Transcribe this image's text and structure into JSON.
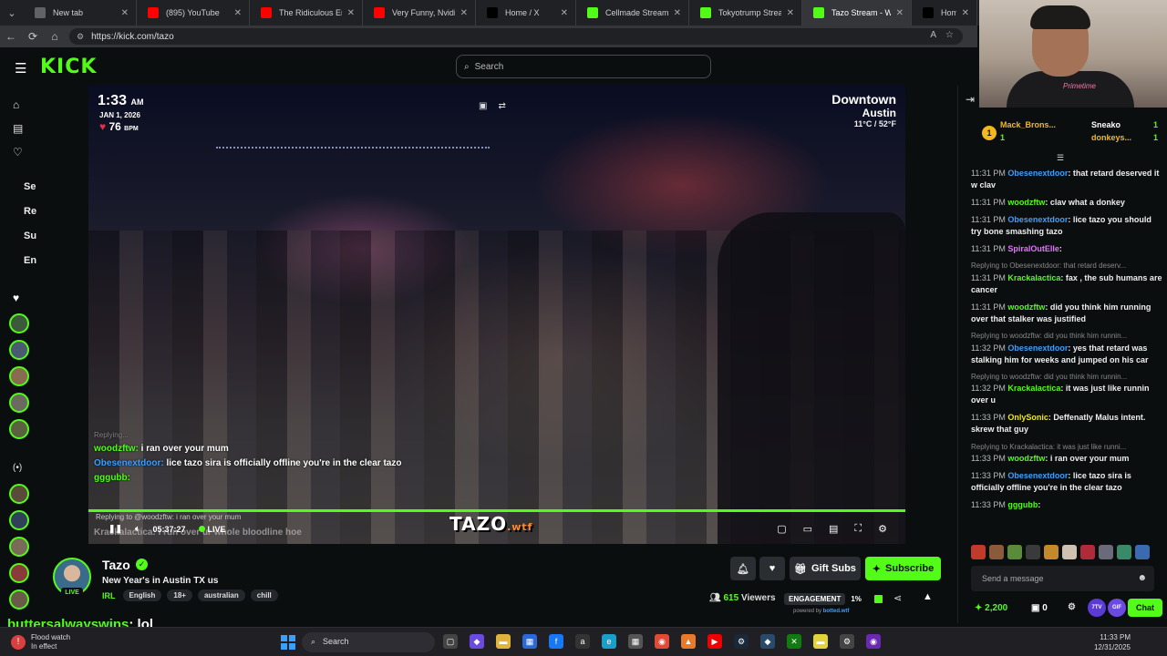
{
  "browser": {
    "tabs": [
      {
        "title": "New tab",
        "color": "#5f6368"
      },
      {
        "title": "(895) YouTube",
        "color": "#ff0000"
      },
      {
        "title": "The Ridiculous Enginee",
        "color": "#ff0000"
      },
      {
        "title": "Very Funny, Nvidia... - Y",
        "color": "#ff0000"
      },
      {
        "title": "Home / X",
        "color": "#000000"
      },
      {
        "title": "Cellmade Stream - K",
        "color": "#53fc18"
      },
      {
        "title": "Tokyotrump Stream",
        "color": "#53fc18"
      },
      {
        "title": "Tazo Stream - Wat",
        "color": "#53fc18"
      },
      {
        "title": "Home / X",
        "color": "#000000"
      }
    ],
    "url": "https://kick.com/tazo"
  },
  "kick": {
    "logo": "KICK",
    "search_placeholder": "Search",
    "sidebar_labels": [
      "Se",
      "Re",
      "Su",
      "En"
    ],
    "accent": "#53fc18"
  },
  "video": {
    "time": "1:33",
    "ampm": "AM",
    "date": "JAN 1, 2026",
    "bpm": "76",
    "bpm_unit": "BPM",
    "location_1": "Downtown",
    "location_2": "Austin",
    "weather": "11°C / 52°F",
    "overlay_chat": [
      {
        "user": "woodzftw:",
        "text": "i ran over your mum",
        "color": "u-green"
      },
      {
        "user": "Obesenextdoor:",
        "text": "lice tazo sira is officially offline you're in the clear tazo",
        "color": "u-blue"
      },
      {
        "user": "gggubb:",
        "text": "",
        "color": "u-green"
      }
    ],
    "overlay_reply": "Replying to @woodzftw: i ran over your mum",
    "overlay_last": "Krackalactica: i run over ur whole bloodline hoe",
    "stream_time": "05:37:27",
    "live_label": "LIVE",
    "watermark": "TAZO",
    "watermark_suffix": ".wtf"
  },
  "stream": {
    "name": "Tazo",
    "live_badge": "LIVE",
    "title": "New Year's in Austin TX us",
    "category": "IRL",
    "tags": [
      "English",
      "18+",
      "australian",
      "chill"
    ],
    "gift_label": "Gift Subs",
    "subscribe_label": "Subscribe",
    "viewers": "615",
    "viewers_label": "Viewers",
    "engagement_label": "ENGAGEMENT",
    "engagement_value": "1%",
    "powered_by": "powered by",
    "powered_brand": "botted.wtf"
  },
  "bottom_message": {
    "user": "buttersalwayswins",
    "text": ": lol"
  },
  "chat": {
    "leaders": [
      {
        "name": "Mack_Brons...",
        "count": "1"
      },
      {
        "name": "Sneako",
        "count": "1"
      },
      {
        "name": "donkeys...",
        "count": "1"
      }
    ],
    "messages": [
      {
        "time": "11:31 PM",
        "user": "Obesenextdoor",
        "ucls": "blue",
        "text": ": that retard deserved it w clav",
        "reply": ""
      },
      {
        "time": "11:31 PM",
        "user": "woodzftw",
        "ucls": "",
        "text": ": clav what a donkey",
        "reply": ""
      },
      {
        "time": "11:31 PM",
        "user": "Obesenextdoor",
        "ucls": "blue",
        "text": ": lice tazo you should try bone smashing tazo",
        "reply": ""
      },
      {
        "time": "11:31 PM",
        "user": "SpiralOutElle",
        "ucls": "pink",
        "text": ":",
        "reply": ""
      },
      {
        "time": "11:31 PM",
        "user": "Krackalactica",
        "ucls": "",
        "text": ": fax , the sub humans are cancer",
        "reply": "Replying to Obesenextdoor: that retard deserv..."
      },
      {
        "time": "11:31 PM",
        "user": "woodzftw",
        "ucls": "",
        "text": ": did you think him running over that stalker was justified",
        "reply": ""
      },
      {
        "time": "11:32 PM",
        "user": "Obesenextdoor",
        "ucls": "blue",
        "text": ": yes that retard was stalking him for weeks and jumped on his car",
        "reply": "Replying to woodzftw: did you think him runnin..."
      },
      {
        "time": "11:32 PM",
        "user": "Krackalactica",
        "ucls": "",
        "text": ": it was just like runnin over u",
        "reply": "Replying to woodzftw: did you think him runnin..."
      },
      {
        "time": "11:33 PM",
        "user": "OnlySonic",
        "ucls": "yellow",
        "text": ": Deffenatly Malus intent. skrew that guy",
        "reply": ""
      },
      {
        "time": "11:33 PM",
        "user": "woodzftw",
        "ucls": "",
        "text": ": i ran over your mum",
        "reply": "Replying to Krackalactica: it was just like runni..."
      },
      {
        "time": "11:33 PM",
        "user": "Obesenextdoor",
        "ucls": "blue",
        "text": ": lice tazo sira is officially offline you're in the clear tazo",
        "reply": ""
      },
      {
        "time": "11:33 PM",
        "user": "gggubb",
        "ucls": "",
        "text": ":",
        "reply": ""
      }
    ],
    "input_placeholder": "Send a message",
    "points": "2,200",
    "tickets": "0",
    "chat_button": "Chat"
  },
  "webcam": {
    "shirt_text": "Primetime"
  },
  "taskbar": {
    "weather_1": "Flood watch",
    "weather_2": "In effect",
    "search": "Search",
    "time": "11:33 PM",
    "date": "12/31/2025"
  }
}
